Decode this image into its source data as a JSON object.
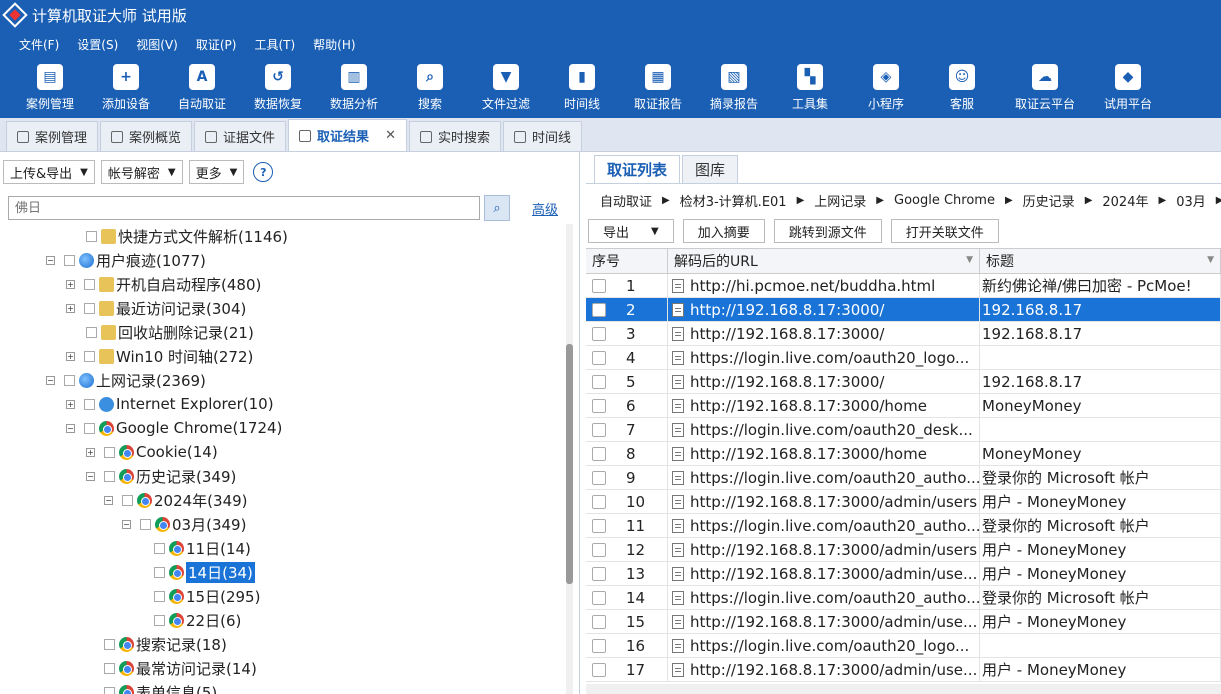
{
  "app": {
    "title": "计算机取证大师 试用版"
  },
  "menu": [
    "文件(F)",
    "设置(S)",
    "视图(V)",
    "取证(P)",
    "工具(T)",
    "帮助(H)"
  ],
  "toolbar": [
    {
      "label": "案例管理",
      "icon": "case-icon"
    },
    {
      "label": "添加设备",
      "icon": "add-device-icon"
    },
    {
      "label": "自动取证",
      "icon": "auto-icon"
    },
    {
      "label": "数据恢复",
      "icon": "recover-icon"
    },
    {
      "label": "数据分析",
      "icon": "analyze-icon"
    },
    {
      "label": "搜索",
      "icon": "search-icon"
    },
    {
      "label": "文件过滤",
      "icon": "filter-icon"
    },
    {
      "label": "时间线",
      "icon": "timeline-icon"
    },
    {
      "label": "取证报告",
      "icon": "report-icon"
    },
    {
      "label": "摘录报告",
      "icon": "excerpt-icon"
    },
    {
      "label": "工具集",
      "icon": "tools-icon"
    },
    {
      "label": "小程序",
      "icon": "miniapp-icon"
    },
    {
      "label": "客服",
      "icon": "support-icon"
    },
    {
      "label": "取证云平台",
      "icon": "cloud-icon"
    },
    {
      "label": "试用平台",
      "icon": "trial-icon"
    }
  ],
  "tabs": [
    {
      "label": "案例管理"
    },
    {
      "label": "案例概览"
    },
    {
      "label": "证据文件"
    },
    {
      "label": "取证结果",
      "close": "✕"
    },
    {
      "label": "实时搜索"
    },
    {
      "label": "时间线"
    }
  ],
  "left": {
    "upload_export": "上传&导出",
    "account_decrypt": "帐号解密",
    "more": "更多",
    "help": "?",
    "search_placeholder": "佛日",
    "advanced": "高级"
  },
  "tree": [
    {
      "label": "快捷方式文件解析(1146)"
    },
    {
      "label": "用户痕迹(1077)"
    },
    {
      "label": "开机自启动程序(480)"
    },
    {
      "label": "最近访问记录(304)"
    },
    {
      "label": "回收站删除记录(21)"
    },
    {
      "label": "Win10 时间轴(272)"
    },
    {
      "label": "上网记录(2369)"
    },
    {
      "label": "Internet Explorer(10)"
    },
    {
      "label": "Google Chrome(1724)"
    },
    {
      "label": "Cookie(14)"
    },
    {
      "label": "历史记录(349)"
    },
    {
      "label": "2024年(349)"
    },
    {
      "label": "03月(349)"
    },
    {
      "label": "11日(14)"
    },
    {
      "label": "14日(34)"
    },
    {
      "label": "15日(295)"
    },
    {
      "label": "22日(6)"
    },
    {
      "label": "搜索记录(18)"
    },
    {
      "label": "最常访问记录(14)"
    },
    {
      "label": "表单信息(5)"
    }
  ],
  "right": {
    "tabs": [
      "取证列表",
      "图库"
    ],
    "breadcrumb": [
      "自动取证",
      "检材3-计算机.E01",
      "上网记录",
      "Google Chrome",
      "历史记录",
      "2024年",
      "03月"
    ],
    "export": "导出",
    "add_excerpt": "加入摘要",
    "jump_source": "跳转到源文件",
    "open_related": "打开关联文件",
    "columns": [
      "序号",
      "解码后的URL",
      "标题"
    ]
  },
  "rows": [
    {
      "n": "1",
      "url": "http://hi.pcmoe.net/buddha.html",
      "title": "新约佛论禅/佛曰加密 - PcMoe!"
    },
    {
      "n": "2",
      "url": "http://192.168.8.17:3000/",
      "title": "192.168.8.17"
    },
    {
      "n": "3",
      "url": "http://192.168.8.17:3000/",
      "title": "192.168.8.17"
    },
    {
      "n": "4",
      "url": "https://login.live.com/oauth20_logo...",
      "title": ""
    },
    {
      "n": "5",
      "url": "http://192.168.8.17:3000/",
      "title": "192.168.8.17"
    },
    {
      "n": "6",
      "url": "http://192.168.8.17:3000/home",
      "title": "MoneyMoney"
    },
    {
      "n": "7",
      "url": "https://login.live.com/oauth20_desk...",
      "title": ""
    },
    {
      "n": "8",
      "url": "http://192.168.8.17:3000/home",
      "title": "MoneyMoney"
    },
    {
      "n": "9",
      "url": "https://login.live.com/oauth20_autho...",
      "title": "登录你的 Microsoft 帐户"
    },
    {
      "n": "10",
      "url": "http://192.168.8.17:3000/admin/users",
      "title": "用户 - MoneyMoney"
    },
    {
      "n": "11",
      "url": "https://login.live.com/oauth20_autho...",
      "title": "登录你的 Microsoft 帐户"
    },
    {
      "n": "12",
      "url": "http://192.168.8.17:3000/admin/users",
      "title": "用户 - MoneyMoney"
    },
    {
      "n": "13",
      "url": "http://192.168.8.17:3000/admin/use...",
      "title": "用户 - MoneyMoney"
    },
    {
      "n": "14",
      "url": "https://login.live.com/oauth20_autho...",
      "title": "登录你的 Microsoft 帐户"
    },
    {
      "n": "15",
      "url": "http://192.168.8.17:3000/admin/use...",
      "title": "用户 - MoneyMoney"
    },
    {
      "n": "16",
      "url": "https://login.live.com/oauth20_logo...",
      "title": ""
    },
    {
      "n": "17",
      "url": "http://192.168.8.17:3000/admin/use...",
      "title": "用户 - MoneyMoney"
    }
  ]
}
